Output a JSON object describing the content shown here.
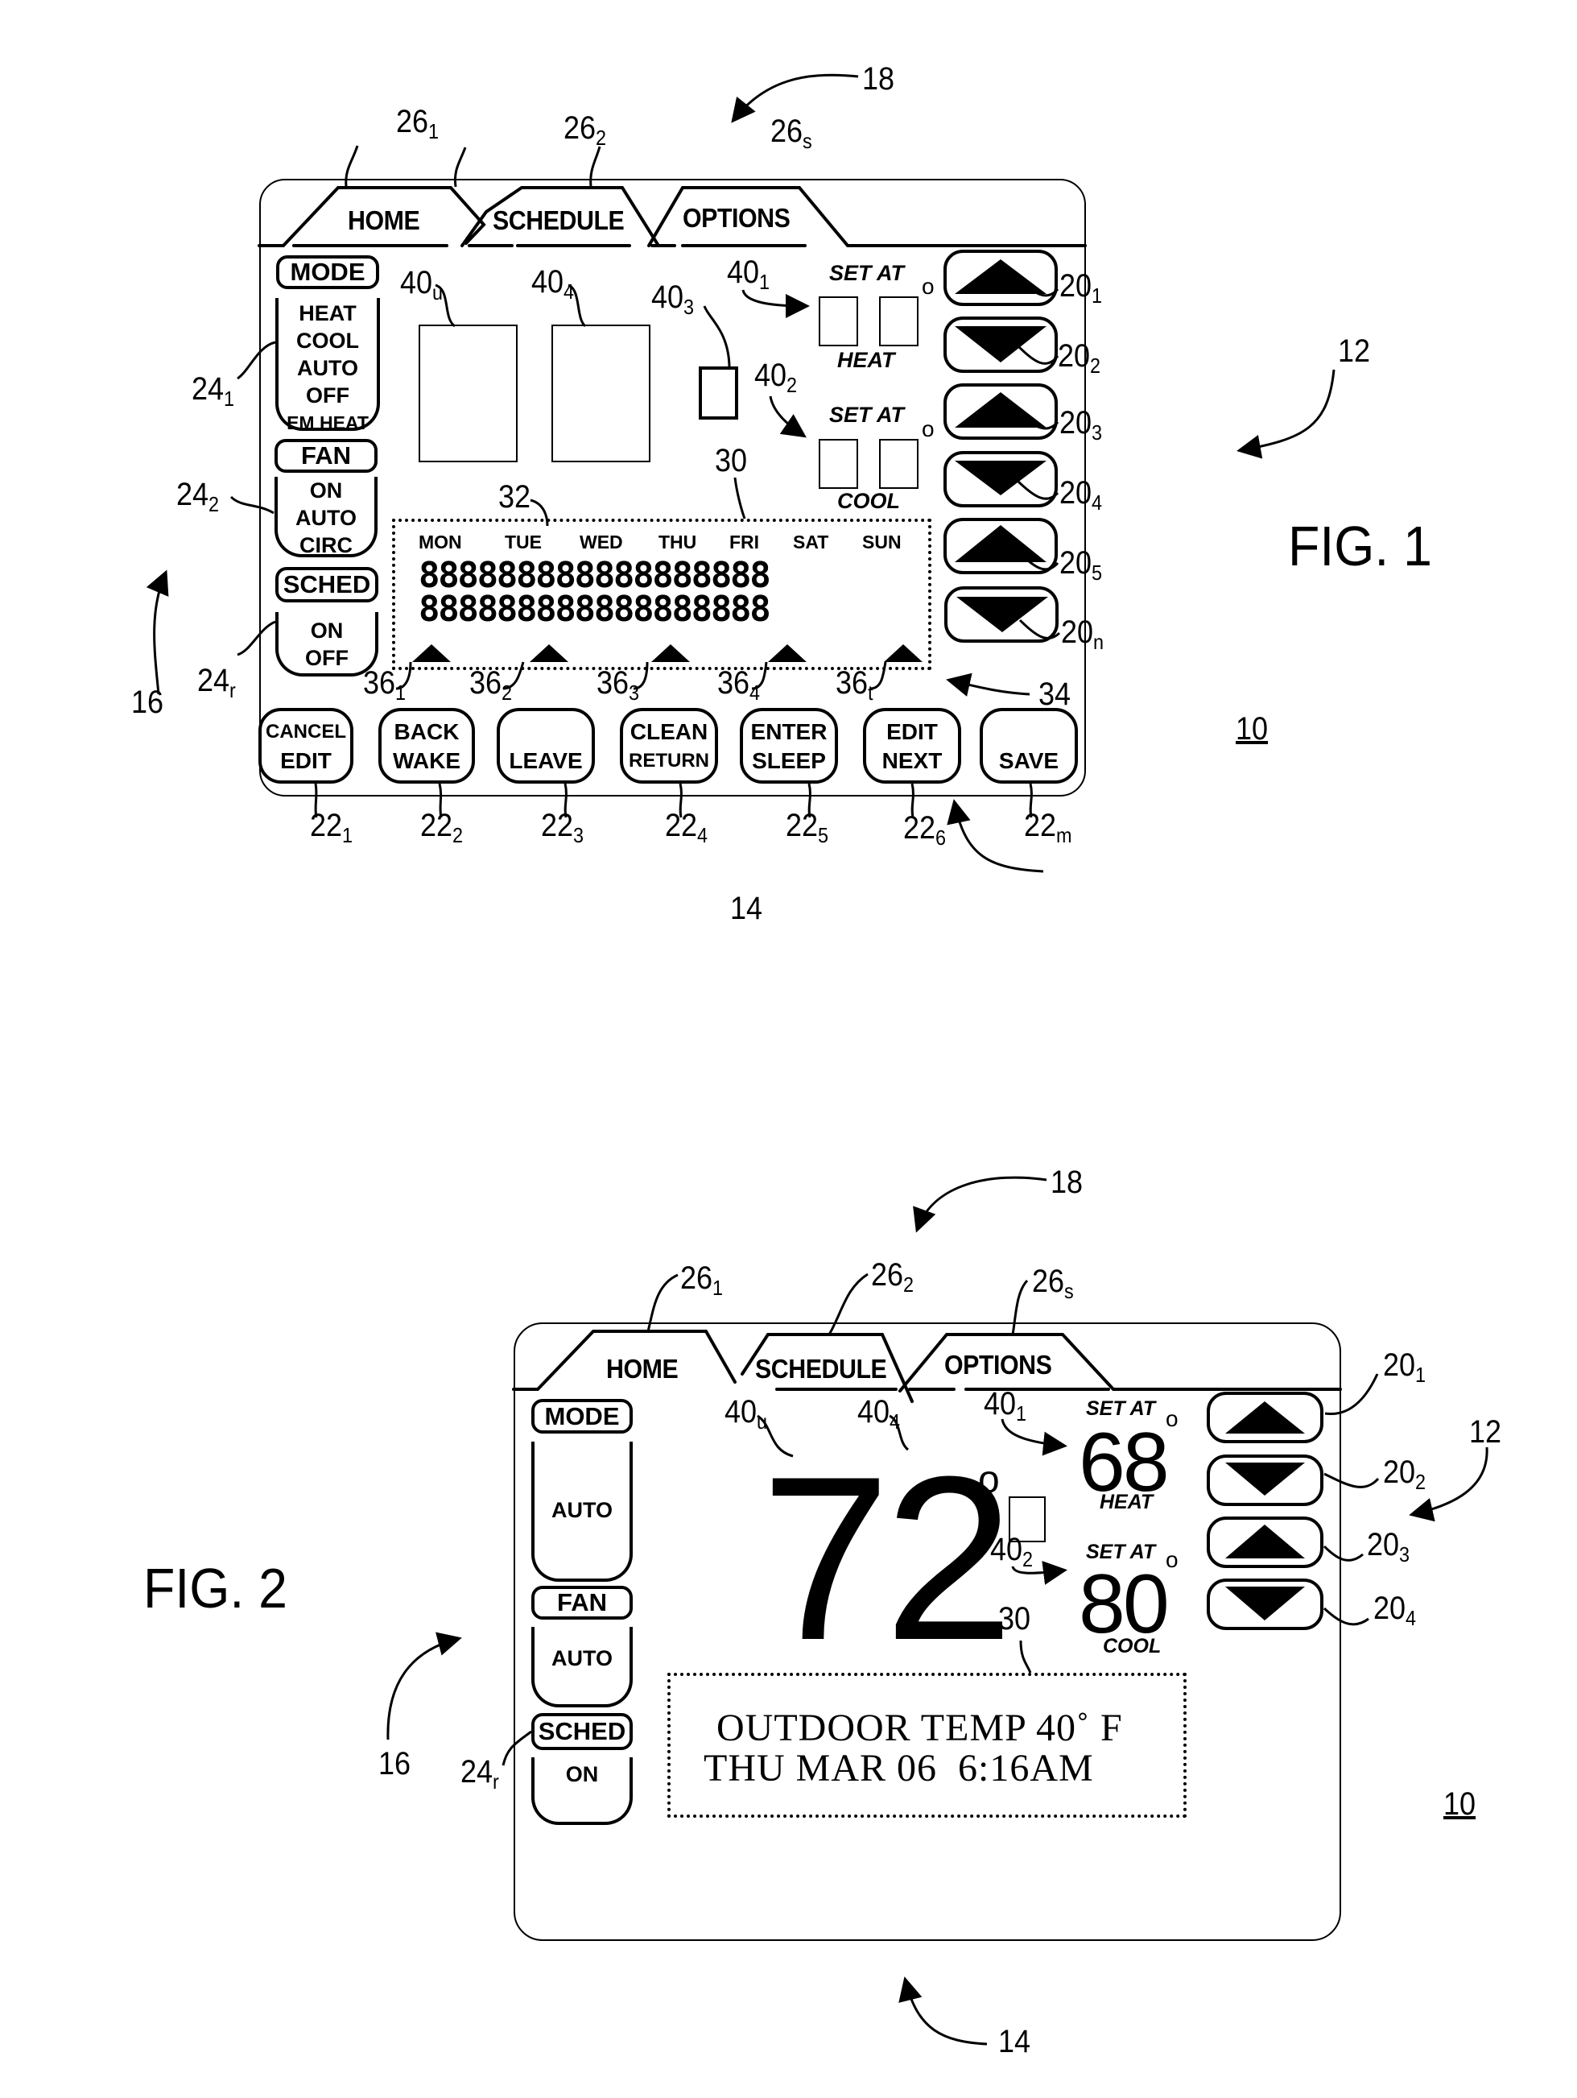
{
  "fig1": {
    "title": "FIG. 1",
    "device_ref": "10",
    "ref_labels": {
      "screen": "18",
      "arrow_keys_group": "12",
      "soft_keys_group": "14",
      "mode_group": "16",
      "schedule_area": "30",
      "day_row": "32",
      "pointer_row": "34"
    },
    "tabs": [
      {
        "label": "HOME",
        "ref": "26",
        "sub": "1"
      },
      {
        "label": "SCHEDULE",
        "ref": "26",
        "sub": "2"
      },
      {
        "label": "OPTIONS",
        "ref": "26",
        "sub": "s"
      }
    ],
    "mode_panels": [
      {
        "header": "MODE",
        "options": [
          "HEAT",
          "COOL",
          "AUTO",
          "OFF",
          "EM HEAT"
        ],
        "ref": "24",
        "sub": "1"
      },
      {
        "header": "FAN",
        "options": [
          "ON",
          "AUTO",
          "CIRC"
        ],
        "ref": "24",
        "sub": "2"
      },
      {
        "header": "SCHED",
        "options": [
          "ON",
          "OFF"
        ],
        "ref": "24",
        "sub": "r"
      }
    ],
    "display_refs": {
      "indoor_tens": {
        "ref": "40",
        "sub": "u"
      },
      "indoor_ones": {
        "ref": "40",
        "sub": "4"
      },
      "indicator": {
        "ref": "40",
        "sub": "3"
      },
      "heat_setpoint": {
        "ref": "40",
        "sub": "1"
      },
      "cool_setpoint": {
        "ref": "40",
        "sub": "2"
      }
    },
    "setpoints": [
      {
        "caption": "SET AT",
        "mode": "HEAT",
        "degree": "o"
      },
      {
        "caption": "SET AT",
        "mode": "COOL",
        "degree": "o"
      }
    ],
    "schedule": {
      "days": [
        "MON",
        "TUE",
        "WED",
        "THU",
        "FRI",
        "SAT",
        "SUN"
      ],
      "segment_rows": [
        "888888888888888888",
        "888888888888888888"
      ],
      "pointers": [
        {
          "ref": "36",
          "sub": "1"
        },
        {
          "ref": "36",
          "sub": "2"
        },
        {
          "ref": "36",
          "sub": "3"
        },
        {
          "ref": "36",
          "sub": "4"
        },
        {
          "ref": "36",
          "sub": "t"
        }
      ]
    },
    "arrow_keys": [
      {
        "direction": "up",
        "icon": "triangle-up-icon",
        "ref": "20",
        "sub": "1"
      },
      {
        "direction": "down",
        "icon": "triangle-down-icon",
        "ref": "20",
        "sub": "2"
      },
      {
        "direction": "up",
        "icon": "triangle-up-icon",
        "ref": "20",
        "sub": "3"
      },
      {
        "direction": "down",
        "icon": "triangle-down-icon",
        "ref": "20",
        "sub": "4"
      },
      {
        "direction": "up",
        "icon": "triangle-up-icon",
        "ref": "20",
        "sub": "5"
      },
      {
        "direction": "down",
        "icon": "triangle-down-icon",
        "ref": "20",
        "sub": "n"
      }
    ],
    "soft_keys": [
      {
        "top": "CANCEL",
        "bottom": "EDIT",
        "ref": "22",
        "sub": "1"
      },
      {
        "top": "BACK",
        "bottom": "WAKE",
        "ref": "22",
        "sub": "2"
      },
      {
        "top": "",
        "bottom": "LEAVE",
        "ref": "22",
        "sub": "3"
      },
      {
        "top": "CLEAN",
        "bottom": "RETURN",
        "ref": "22",
        "sub": "4"
      },
      {
        "top": "ENTER",
        "bottom": "SLEEP",
        "ref": "22",
        "sub": "5"
      },
      {
        "top": "EDIT",
        "bottom": "NEXT",
        "ref": "22",
        "sub": "6"
      },
      {
        "top": "",
        "bottom": "SAVE",
        "ref": "22",
        "sub": "m"
      }
    ]
  },
  "fig2": {
    "title": "FIG. 2",
    "device_ref": "10",
    "ref_labels": {
      "screen": "18",
      "arrow_keys_group": "12",
      "soft_keys_group": "14",
      "mode_group": "16",
      "info_area": "30"
    },
    "tabs": [
      {
        "label": "HOME",
        "ref": "26",
        "sub": "1"
      },
      {
        "label": "SCHEDULE",
        "ref": "26",
        "sub": "2"
      },
      {
        "label": "OPTIONS",
        "ref": "26",
        "sub": "s"
      }
    ],
    "mode_panels": [
      {
        "header": "MODE",
        "value": "AUTO"
      },
      {
        "header": "FAN",
        "value": "AUTO"
      },
      {
        "header": "SCHED",
        "value": "ON",
        "ref": "24",
        "sub": "r"
      }
    ],
    "indoor_temp": {
      "value": "72",
      "degree": "o",
      "ref_tens": {
        "ref": "40",
        "sub": "u"
      },
      "ref_ones": {
        "ref": "40",
        "sub": "4"
      }
    },
    "setpoints": [
      {
        "caption": "SET AT",
        "value": "68",
        "mode": "HEAT",
        "degree": "o",
        "ref": "40",
        "sub": "1"
      },
      {
        "caption": "SET AT",
        "value": "80",
        "mode": "COOL",
        "degree": "o",
        "ref": "40",
        "sub": "2"
      }
    ],
    "info_lines": [
      "OUTDOOR TEMP 40˚ F",
      "THU MAR 06  6:16AM"
    ],
    "arrow_keys": [
      {
        "direction": "up",
        "ref": "20",
        "sub": "1"
      },
      {
        "direction": "down",
        "ref": "20",
        "sub": "2"
      },
      {
        "direction": "up",
        "ref": "20",
        "sub": "3"
      },
      {
        "direction": "down",
        "ref": "20",
        "sub": "4"
      }
    ]
  }
}
